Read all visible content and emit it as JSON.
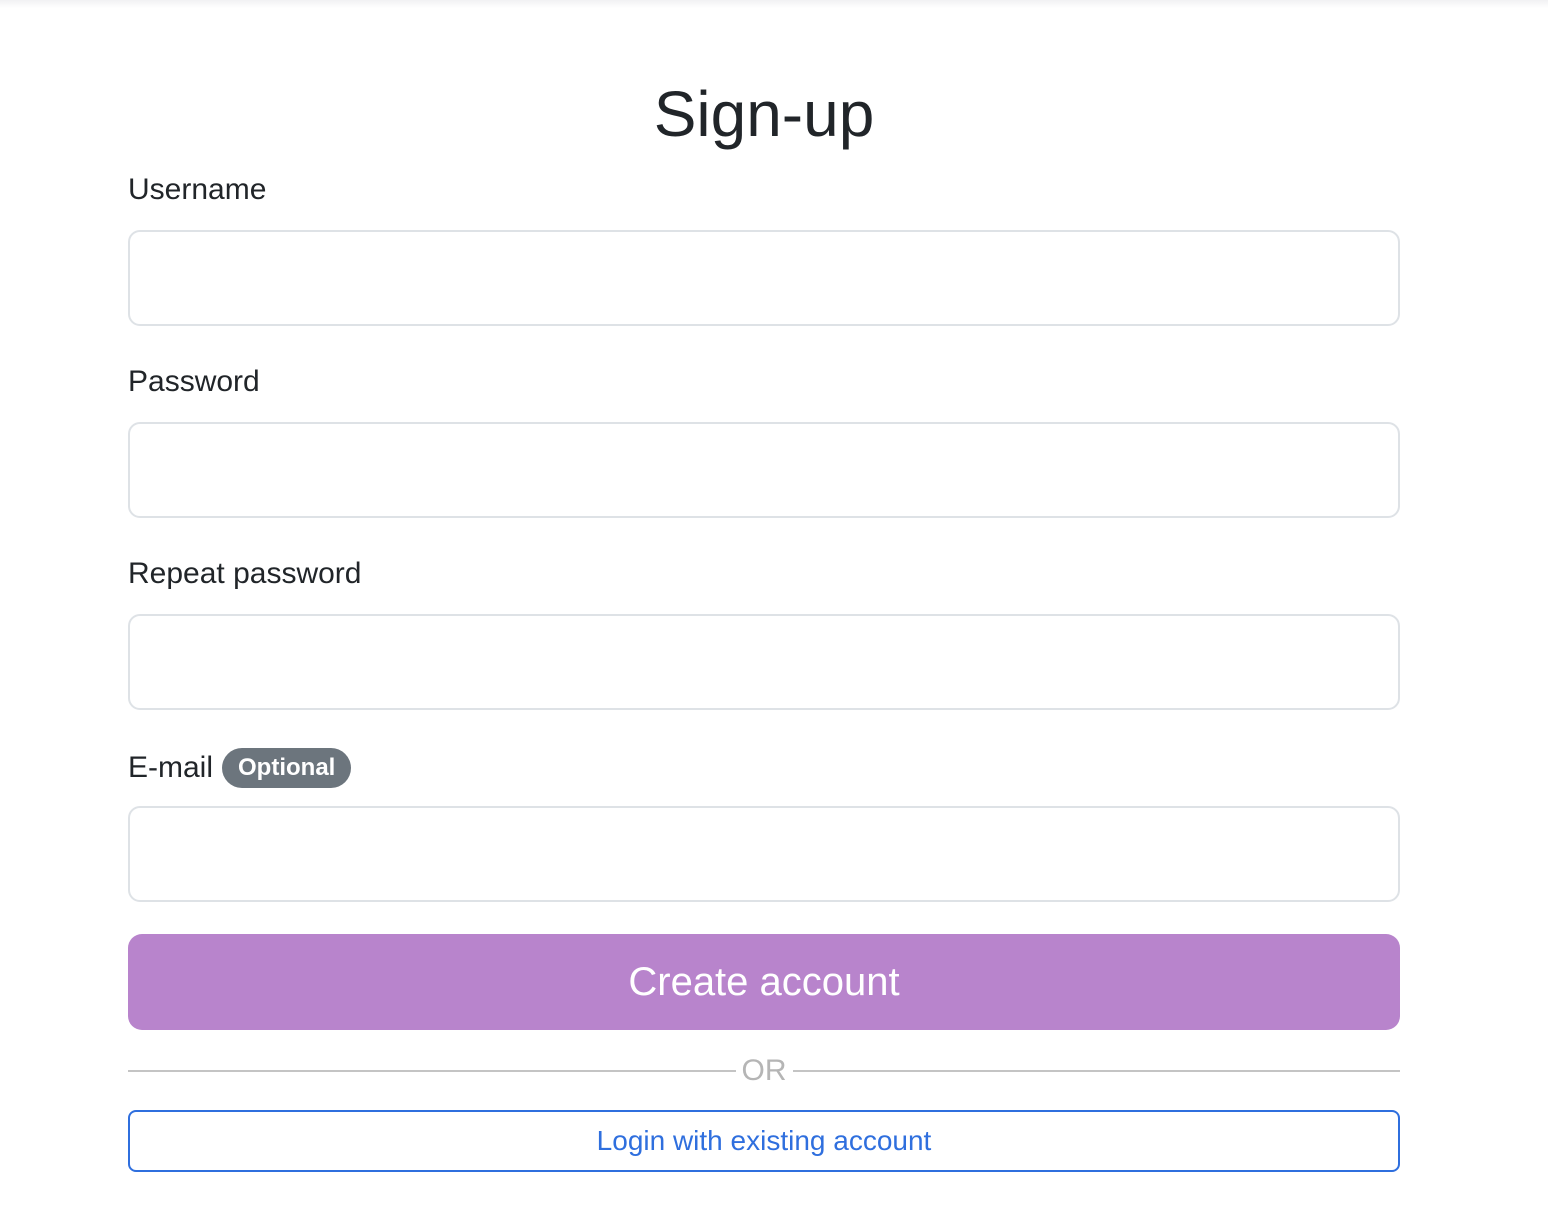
{
  "title": "Sign-up",
  "fields": {
    "username": {
      "label": "Username",
      "value": ""
    },
    "password": {
      "label": "Password",
      "value": ""
    },
    "repeat_password": {
      "label": "Repeat password",
      "value": ""
    },
    "email": {
      "label": "E-mail",
      "badge": "Optional",
      "value": ""
    }
  },
  "actions": {
    "create_label": "Create account",
    "divider_label": "OR",
    "login_label": "Login with existing account"
  },
  "colors": {
    "primary_button": "#b884cc",
    "link": "#2f6fde",
    "badge": "#6c757d"
  }
}
